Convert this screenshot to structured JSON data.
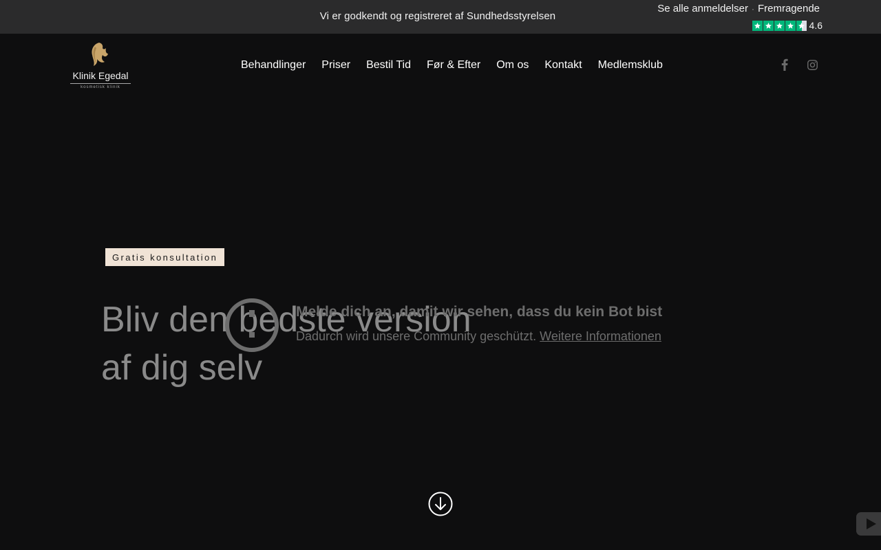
{
  "topbar": {
    "notice": "Vi er godkendt og registreret af Sundhedsstyrelsen",
    "reviews_link": "Se alle anmeldelser",
    "rating_text": "Fremragende",
    "rating_score": "4.6",
    "stars": 4.6,
    "star_color": "#00b67a"
  },
  "logo": {
    "name": "Klinik Egedal",
    "tagline": "kosmetisk klinik",
    "accent": "#c9a56a"
  },
  "nav": {
    "items": [
      "Behandlinger",
      "Priser",
      "Bestil Tid",
      "Før & Efter",
      "Om os",
      "Kontakt",
      "Medlemsklub"
    ]
  },
  "social": {
    "facebook_icon": "facebook-icon",
    "instagram_icon": "instagram-icon"
  },
  "hero": {
    "badge": "Gratis konsultation",
    "headline_line1": "Bliv den bedste version",
    "headline_line2": "af dig selv"
  },
  "overlay": {
    "title": "Melde dich an, damit wir sehen, dass du kein Bot bist",
    "text": "Dadurch wird unsere Community geschützt.",
    "link": "Weitere Informationen"
  },
  "icons": {
    "scroll": "arrow-down-circle-icon",
    "play": "play-icon",
    "info": "info-circle-icon"
  }
}
